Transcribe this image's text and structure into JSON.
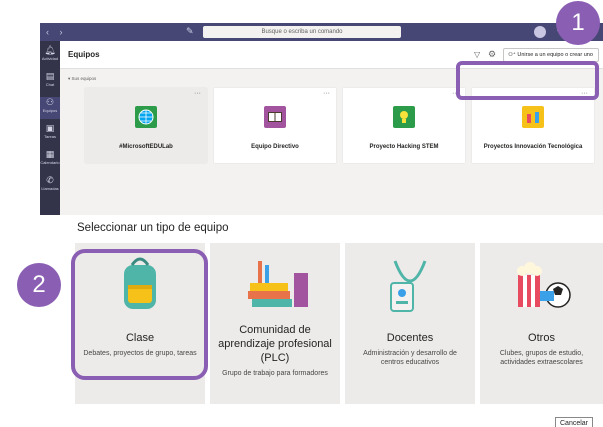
{
  "callouts": {
    "one": "1",
    "two": "2"
  },
  "titlebar": {
    "nav": "‹ ›",
    "search_placeholder": "Busque o escriba un comando",
    "minimize": "–",
    "maximize": "□",
    "close": "×"
  },
  "rail": [
    {
      "label": "Actividad",
      "icon": "bell-icon"
    },
    {
      "label": "Chat",
      "icon": "chat-icon"
    },
    {
      "label": "Equipos",
      "icon": "teams-icon"
    },
    {
      "label": "Tareas",
      "icon": "assignments-icon"
    },
    {
      "label": "Calendario",
      "icon": "calendar-icon"
    },
    {
      "label": "Llamadas",
      "icon": "phone-icon"
    }
  ],
  "teams_page": {
    "title": "Equipos",
    "section_label": "▾ Sus equipos",
    "join_button": "Unirse a un equipo o crear uno",
    "cards": [
      {
        "name": "#MicrosoftEDULab",
        "color": "#00a4ef"
      },
      {
        "name": "Equipo Directivo",
        "color": "#a3549e"
      },
      {
        "name": "Proyecto Hacking STEM",
        "color": "#2d9c4a"
      },
      {
        "name": "Proyectos Innovación Tecnológica",
        "color": "#f6c21a"
      }
    ]
  },
  "dialog": {
    "title": "Seleccionar un tipo de equipo",
    "types": [
      {
        "name": "Clase",
        "description": "Debates, proyectos de grupo, tareas"
      },
      {
        "name": "Comunidad de aprendizaje profesional (PLC)",
        "description": "Grupo de trabajo para formadores"
      },
      {
        "name": "Docentes",
        "description": "Administración y desarrollo de centros educativos"
      },
      {
        "name": "Otros",
        "description": "Clubes, grupos de estudio, actividades extraescolares"
      }
    ],
    "cancel": "Cancelar"
  },
  "colors": {
    "accent": "#8a5eb3",
    "titlebar": "#464775",
    "rail": "#33344a"
  }
}
